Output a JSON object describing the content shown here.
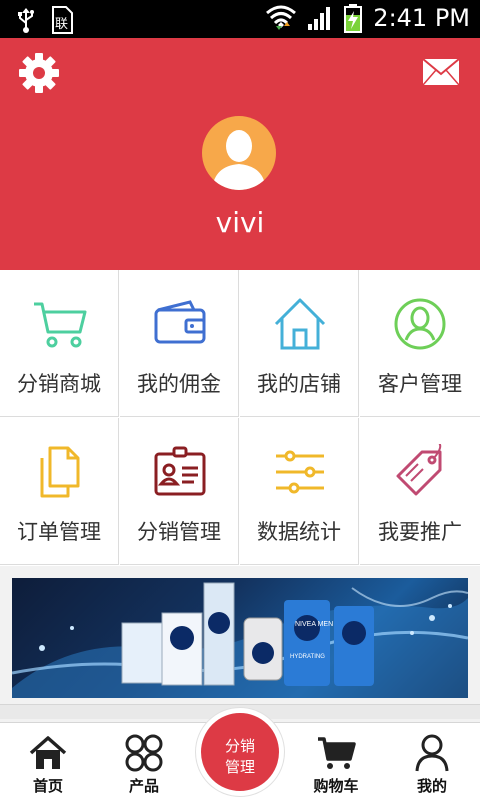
{
  "status_bar": {
    "time": "2:41 PM",
    "sim_label": "联"
  },
  "header": {
    "username": "vivi"
  },
  "grid_items": [
    {
      "label": "分销商城",
      "icon": "cart-icon",
      "color": "#4dcf9f"
    },
    {
      "label": "我的佣金",
      "icon": "wallet-icon",
      "color": "#3f6fd1"
    },
    {
      "label": "我的店铺",
      "icon": "house-icon",
      "color": "#44b0d8"
    },
    {
      "label": "客户管理",
      "icon": "user-circle-icon",
      "color": "#6ecf58"
    },
    {
      "label": "订单管理",
      "icon": "documents-icon",
      "color": "#f0b82a"
    },
    {
      "label": "分销管理",
      "icon": "id-card-icon",
      "color": "#8a1e22"
    },
    {
      "label": "数据统计",
      "icon": "sliders-icon",
      "color": "#f0b82a"
    },
    {
      "label": "我要推广",
      "icon": "tag-icon",
      "color": "#c04a72"
    }
  ],
  "banner": {
    "brand": "NIVEA MEN",
    "product_line": "HYDRATING"
  },
  "tab_bar": {
    "home": "首页",
    "products": "产品",
    "center_line1": "分销",
    "center_line2": "管理",
    "cart": "购物车",
    "mine": "我的"
  },
  "colors": {
    "brand_red": "#dd3a45",
    "avatar_orange": "#f7a84a"
  }
}
